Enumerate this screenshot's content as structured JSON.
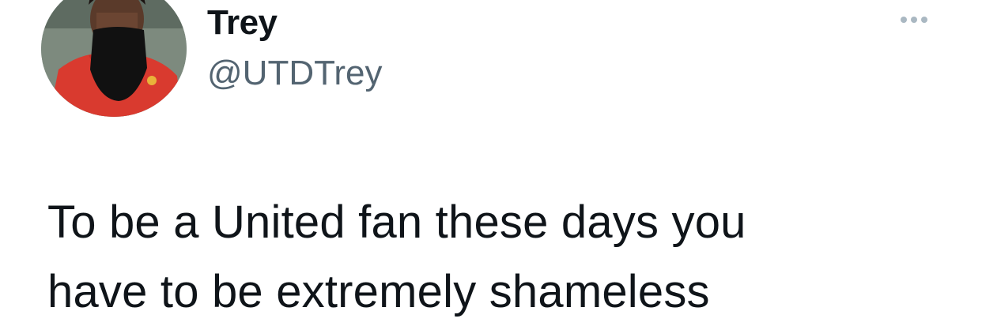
{
  "author": {
    "display_name": "Trey",
    "handle": "@UTDTrey",
    "avatar_icon": "profile-photo"
  },
  "tweet": {
    "text_lines": [
      "To be a United fan these days you",
      "have to be extremely shameless"
    ]
  },
  "actions": {
    "more_icon": "more-options-icon"
  },
  "colors": {
    "name": "#0f1419",
    "handle": "#536471",
    "dots": "#aab8c2",
    "background": "#ffffff"
  }
}
